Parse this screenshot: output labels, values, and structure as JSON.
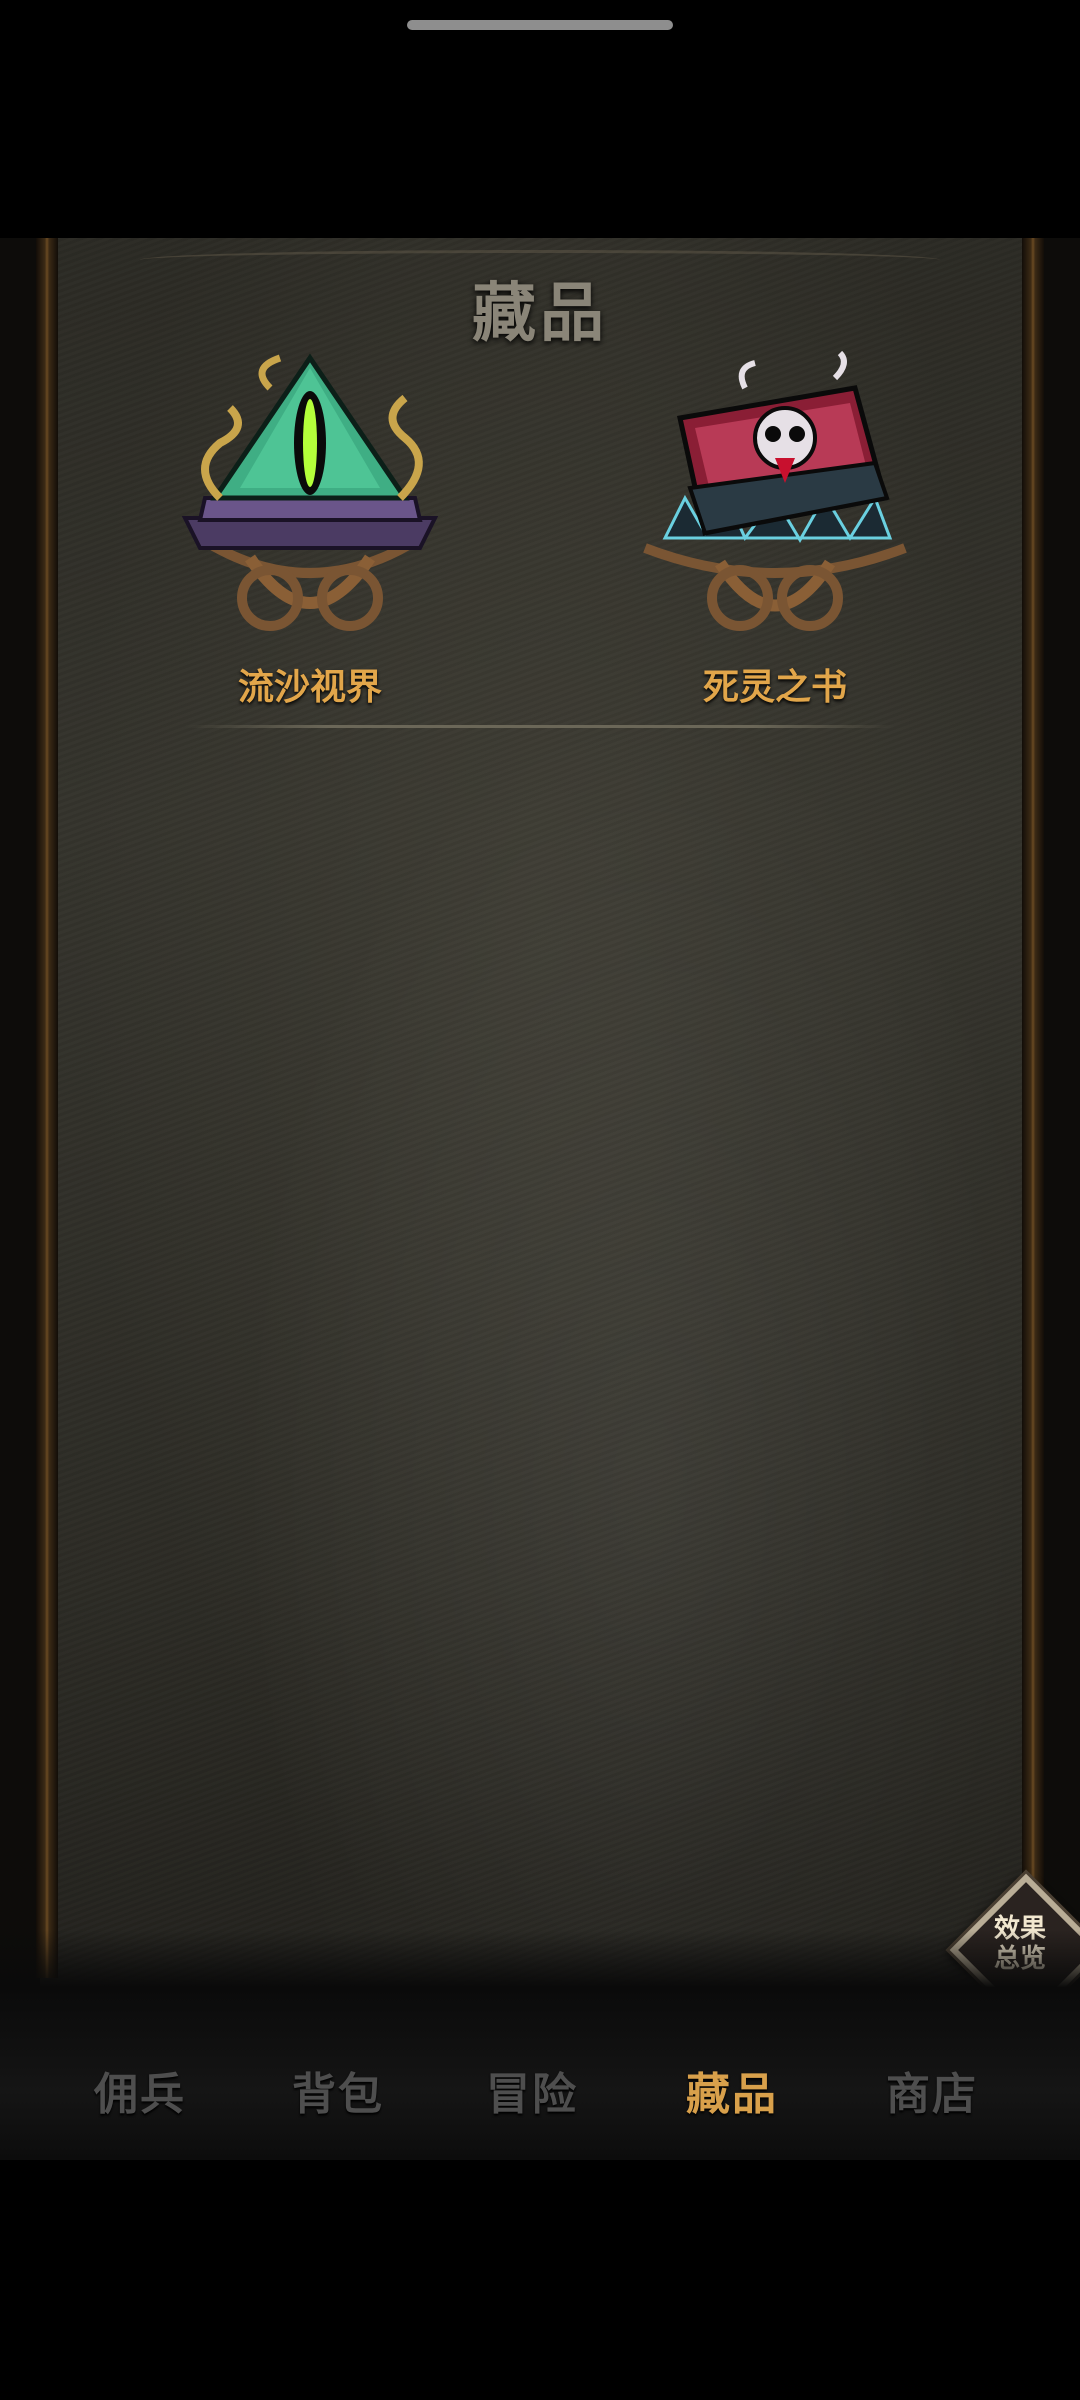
{
  "page": {
    "title": "藏品"
  },
  "collection": [
    {
      "name": "流沙视界",
      "icon": "sand-eye-relic-icon"
    },
    {
      "name": "死灵之书",
      "icon": "necronomicon-book-icon"
    }
  ],
  "effects_button": {
    "label": "效果\n总览"
  },
  "tabs": [
    {
      "label": "佣兵",
      "active": false
    },
    {
      "label": "背包",
      "active": false
    },
    {
      "label": "冒险",
      "active": false
    },
    {
      "label": "藏品",
      "active": true
    },
    {
      "label": "商店",
      "active": false
    }
  ],
  "colors": {
    "accent_gold": "#d8a04b",
    "item_label": "#e2a64a",
    "inactive_tab": "#4e4e4e",
    "panel_bg": "#2f2e28"
  }
}
